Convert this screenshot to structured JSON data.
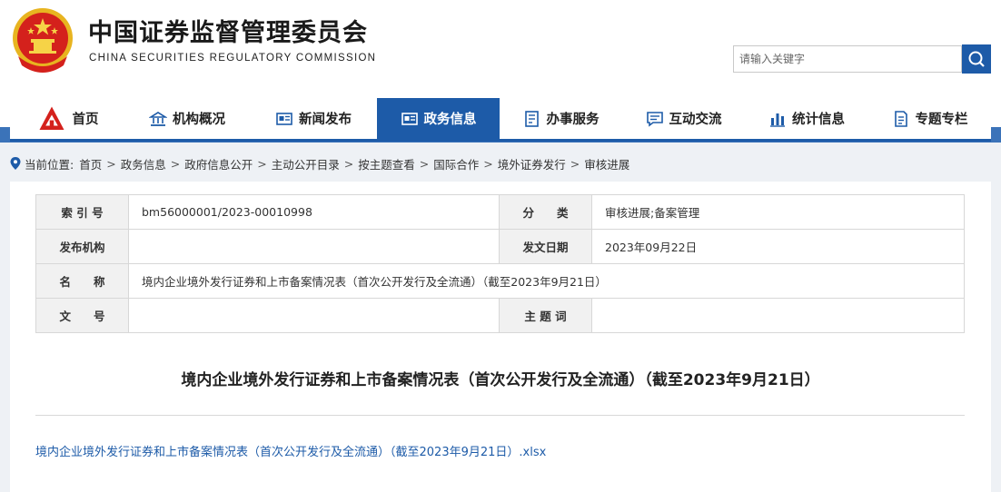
{
  "header": {
    "title": "中国证券监督管理委员会",
    "subtitle": "CHINA SECURITIES REGULATORY COMMISSION",
    "search_placeholder": "请输入关键字",
    "brand_color": "#1d5ba8"
  },
  "nav": {
    "items": [
      {
        "label": "首页",
        "icon": "csrc-logo-icon"
      },
      {
        "label": "机构概况",
        "icon": "building-icon"
      },
      {
        "label": "新闻发布",
        "icon": "news-icon"
      },
      {
        "label": "政务信息",
        "icon": "gov-info-icon",
        "active": true
      },
      {
        "label": "办事服务",
        "icon": "service-list-icon"
      },
      {
        "label": "互动交流",
        "icon": "chat-icon"
      },
      {
        "label": "统计信息",
        "icon": "bar-chart-icon"
      },
      {
        "label": "专题专栏",
        "icon": "document-icon"
      }
    ]
  },
  "breadcrumb": {
    "prefix": "当前位置:",
    "items": [
      "首页",
      "政务信息",
      "政府信息公开",
      "主动公开目录",
      "按主题查看",
      "国际合作",
      "境外证券发行",
      "审核进展"
    ]
  },
  "meta_table": {
    "index_label": "索 引 号",
    "index_value": "bm56000001/2023-00010998",
    "category_label": "分　　类",
    "category_value": "审核进展;备案管理",
    "publisher_label": "发布机构",
    "publisher_value": "",
    "date_label": "发文日期",
    "date_value": "2023年09月22日",
    "name_label": "名　　称",
    "name_value": "境内企业境外发行证券和上市备案情况表（首次公开发行及全流通）（截至2023年9月21日）",
    "doc_no_label": "文　　号",
    "doc_no_value": "",
    "subject_label": "主 题 词",
    "subject_value": ""
  },
  "article": {
    "title": "境内企业境外发行证券和上市备案情况表（首次公开发行及全流通）（截至2023年9月21日）",
    "attachment": "境内企业境外发行证券和上市备案情况表（首次公开发行及全流通）（截至2023年9月21日）.xlsx"
  }
}
